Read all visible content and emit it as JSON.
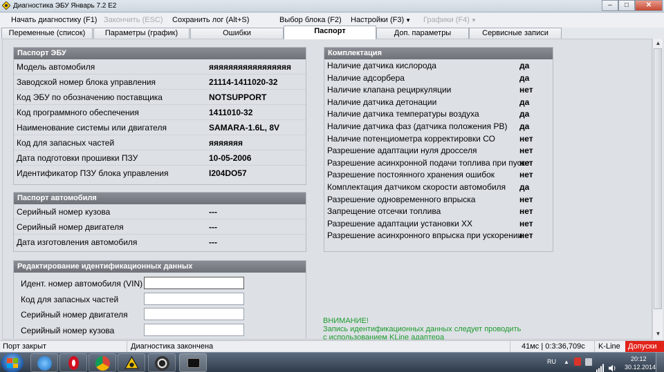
{
  "window": {
    "title": "Диагностика ЭБУ Январь 7.2 E2",
    "minimize": "–",
    "maximize": "□",
    "close": "✕"
  },
  "toolbar": {
    "start_diag": "Начать диагностику (F1)",
    "finish": "Закончить (ESC)",
    "save_log": "Сохранить лог (Alt+S)",
    "select_block": "Выбор блока (F2)",
    "settings": "Настройки (F3)",
    "charts": "Графики (F4)"
  },
  "tabs": [
    {
      "label": "Переменные (список)"
    },
    {
      "label": "Параметры (график)"
    },
    {
      "label": "Ошибки"
    },
    {
      "label": "Паспорт"
    },
    {
      "label": "Доп. параметры"
    },
    {
      "label": "Сервисные записи"
    }
  ],
  "active_tab": "Паспорт",
  "ecu_passport": {
    "header": "Паспорт ЭБУ",
    "rows": [
      {
        "label": "Модель автомобиля",
        "value": "яяяяяяяяяяяяяяяяя"
      },
      {
        "label": "Заводской номер блока управления",
        "value": "21114-1411020-32"
      },
      {
        "label": "Код ЭБУ по обозначению поставщика",
        "value": "NOTSUPPORT"
      },
      {
        "label": "Код программного обеспечения",
        "value": "1411010-32"
      },
      {
        "label": "Наименование системы или двигателя",
        "value": "SAMARA-1.6L, 8V"
      },
      {
        "label": "Код для запасных частей",
        "value": "яяяяяяя"
      },
      {
        "label": "Дата подготовки прошивки ПЗУ",
        "value": "10-05-2006"
      },
      {
        "label": "Идентификатор ПЗУ блока управления",
        "value": "I204DO57"
      }
    ]
  },
  "car_passport": {
    "header": "Паспорт автомобиля",
    "rows": [
      {
        "label": "Серийный номер кузова",
        "value": "---"
      },
      {
        "label": "Серийный номер двигателя",
        "value": "---"
      },
      {
        "label": "Дата изготовления автомобиля",
        "value": "---"
      }
    ]
  },
  "edit_id": {
    "header": "Редактирование идентификационных данных",
    "fields": [
      {
        "label": "Идент. номер автомобиля (VIN)",
        "value": ""
      },
      {
        "label": "Код для запасных частей",
        "value": ""
      },
      {
        "label": "Серийный номер двигателя",
        "value": ""
      },
      {
        "label": "Серийный номер кузова",
        "value": ""
      }
    ]
  },
  "equipment": {
    "header": "Комплектация",
    "rows": [
      {
        "label": "Наличие датчика кислорода",
        "value": "да"
      },
      {
        "label": "Наличие адсорбера",
        "value": "да"
      },
      {
        "label": "Наличие клапана рециркуляции",
        "value": "нет"
      },
      {
        "label": "Наличие датчика детонации",
        "value": "да"
      },
      {
        "label": "Наличие датчика температуры воздуха",
        "value": "да"
      },
      {
        "label": "Наличие датчика фаз (датчика положения РВ)",
        "value": "да"
      },
      {
        "label": "Наличие потенциометра корректировки СО",
        "value": "нет"
      },
      {
        "label": "Разрешение адаптации нуля дросселя",
        "value": "нет"
      },
      {
        "label": "Разрешение асинхронной подачи топлива при пуске",
        "value": "нет"
      },
      {
        "label": "Разрешение постоянного хранения ошибок",
        "value": "нет"
      },
      {
        "label": "Комплектация датчиком скорости автомобиля",
        "value": "да"
      },
      {
        "label": "Разрешение одновременного впрыска",
        "value": "нет"
      },
      {
        "label": "Запрещение отсечки топлива",
        "value": "нет"
      },
      {
        "label": "Разрешение адаптации установки ХХ",
        "value": "нет"
      },
      {
        "label": "Разрешение асинхронного впрыска при ускорении",
        "value": "нет"
      }
    ]
  },
  "warning": {
    "line1": "ВНИМАНИЕ!",
    "line2": "Запись идентификационных данных следует проводить",
    "line3": "с использованием KLine адаптера"
  },
  "status": {
    "port": "Порт закрыт",
    "diag": "Диагностика закончена",
    "timing": "41мс | 0:3:36,709с",
    "protocol": "K-Line",
    "alert": "Допуски"
  },
  "taskbar": {
    "lang": "RU",
    "time": "20:12",
    "date": "30.12.2014"
  },
  "colors": {
    "group_header": "#7d8187",
    "warning": "#1d9a2c",
    "alert": "#e2231a"
  }
}
